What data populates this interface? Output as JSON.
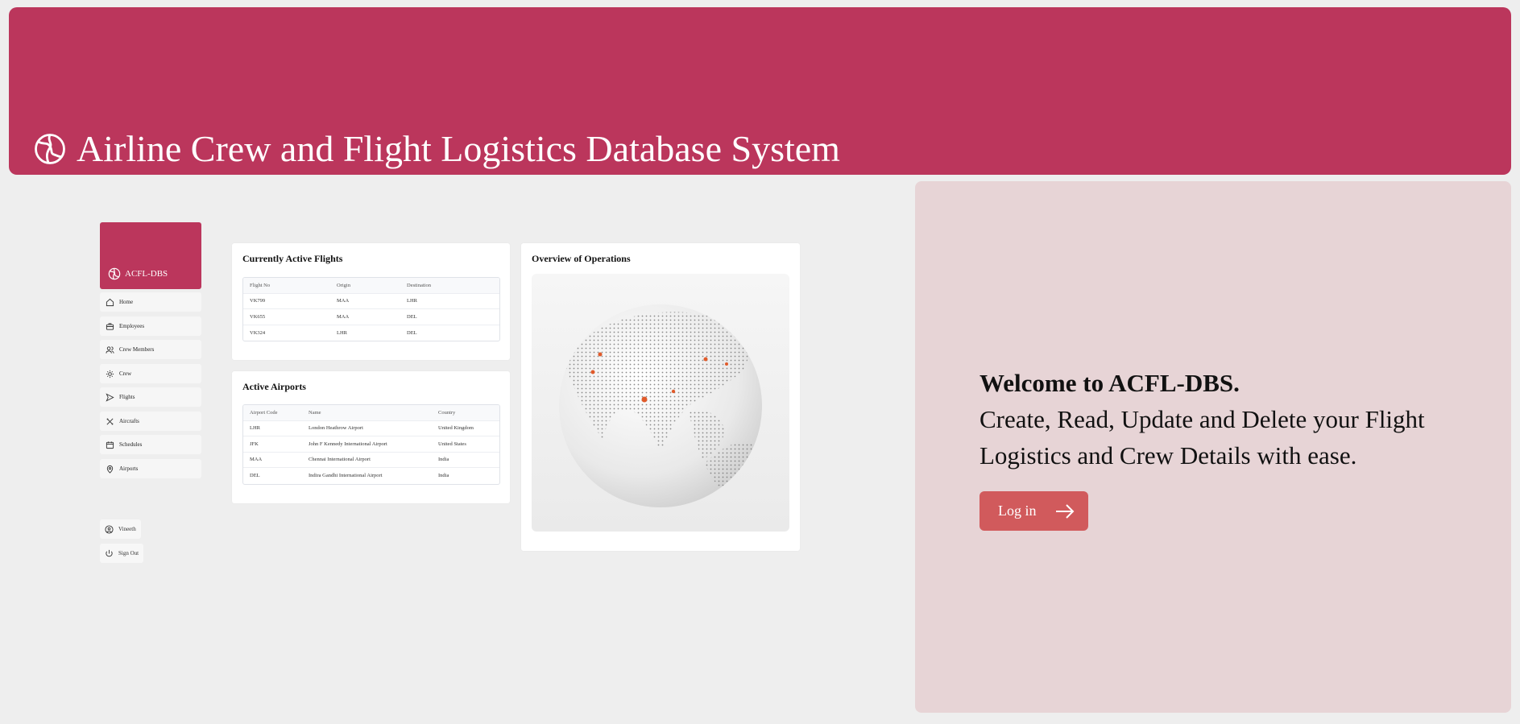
{
  "header": {
    "title": "Airline Crew and Flight Logistics Database System",
    "icon": "globe-icon"
  },
  "welcome": {
    "heading": "Welcome to ACFL-DBS.",
    "body": "Create, Read, Update and Delete your Flight Logistics and Crew Details with ease.",
    "login_label": "Log in"
  },
  "preview": {
    "brand": "ACFL-DBS",
    "nav": [
      "Home",
      "Employees",
      "Crew Members",
      "Crew",
      "Flights",
      "Aircrafts",
      "Schedules",
      "Airports"
    ],
    "user": "Vineeth",
    "signout": "Sign Out",
    "flights": {
      "title": "Currently Active Flights",
      "headers": [
        "Flight No",
        "Origin",
        "Destination"
      ],
      "rows": [
        [
          "VK799",
          "MAA",
          "LHR"
        ],
        [
          "VK655",
          "MAA",
          "DEL"
        ],
        [
          "VK324",
          "LHR",
          "DEL"
        ]
      ]
    },
    "airports": {
      "title": "Active Airports",
      "headers": [
        "Airport Code",
        "Name",
        "Country"
      ],
      "rows": [
        [
          "LHR",
          "London Heathrow Airport",
          "United Kingdom"
        ],
        [
          "JFK",
          "John F Kennedy International Airport",
          "United States"
        ],
        [
          "MAA",
          "Chennai International Airport",
          "India"
        ],
        [
          "DEL",
          "Indira Gandhi International Airport",
          "India"
        ]
      ]
    },
    "overview": {
      "title": "Overview of Operations"
    }
  },
  "colors": {
    "brand": "#bb365c",
    "panel": "#e7d4d6",
    "button": "#d15a5c",
    "background": "#eeeeee"
  }
}
